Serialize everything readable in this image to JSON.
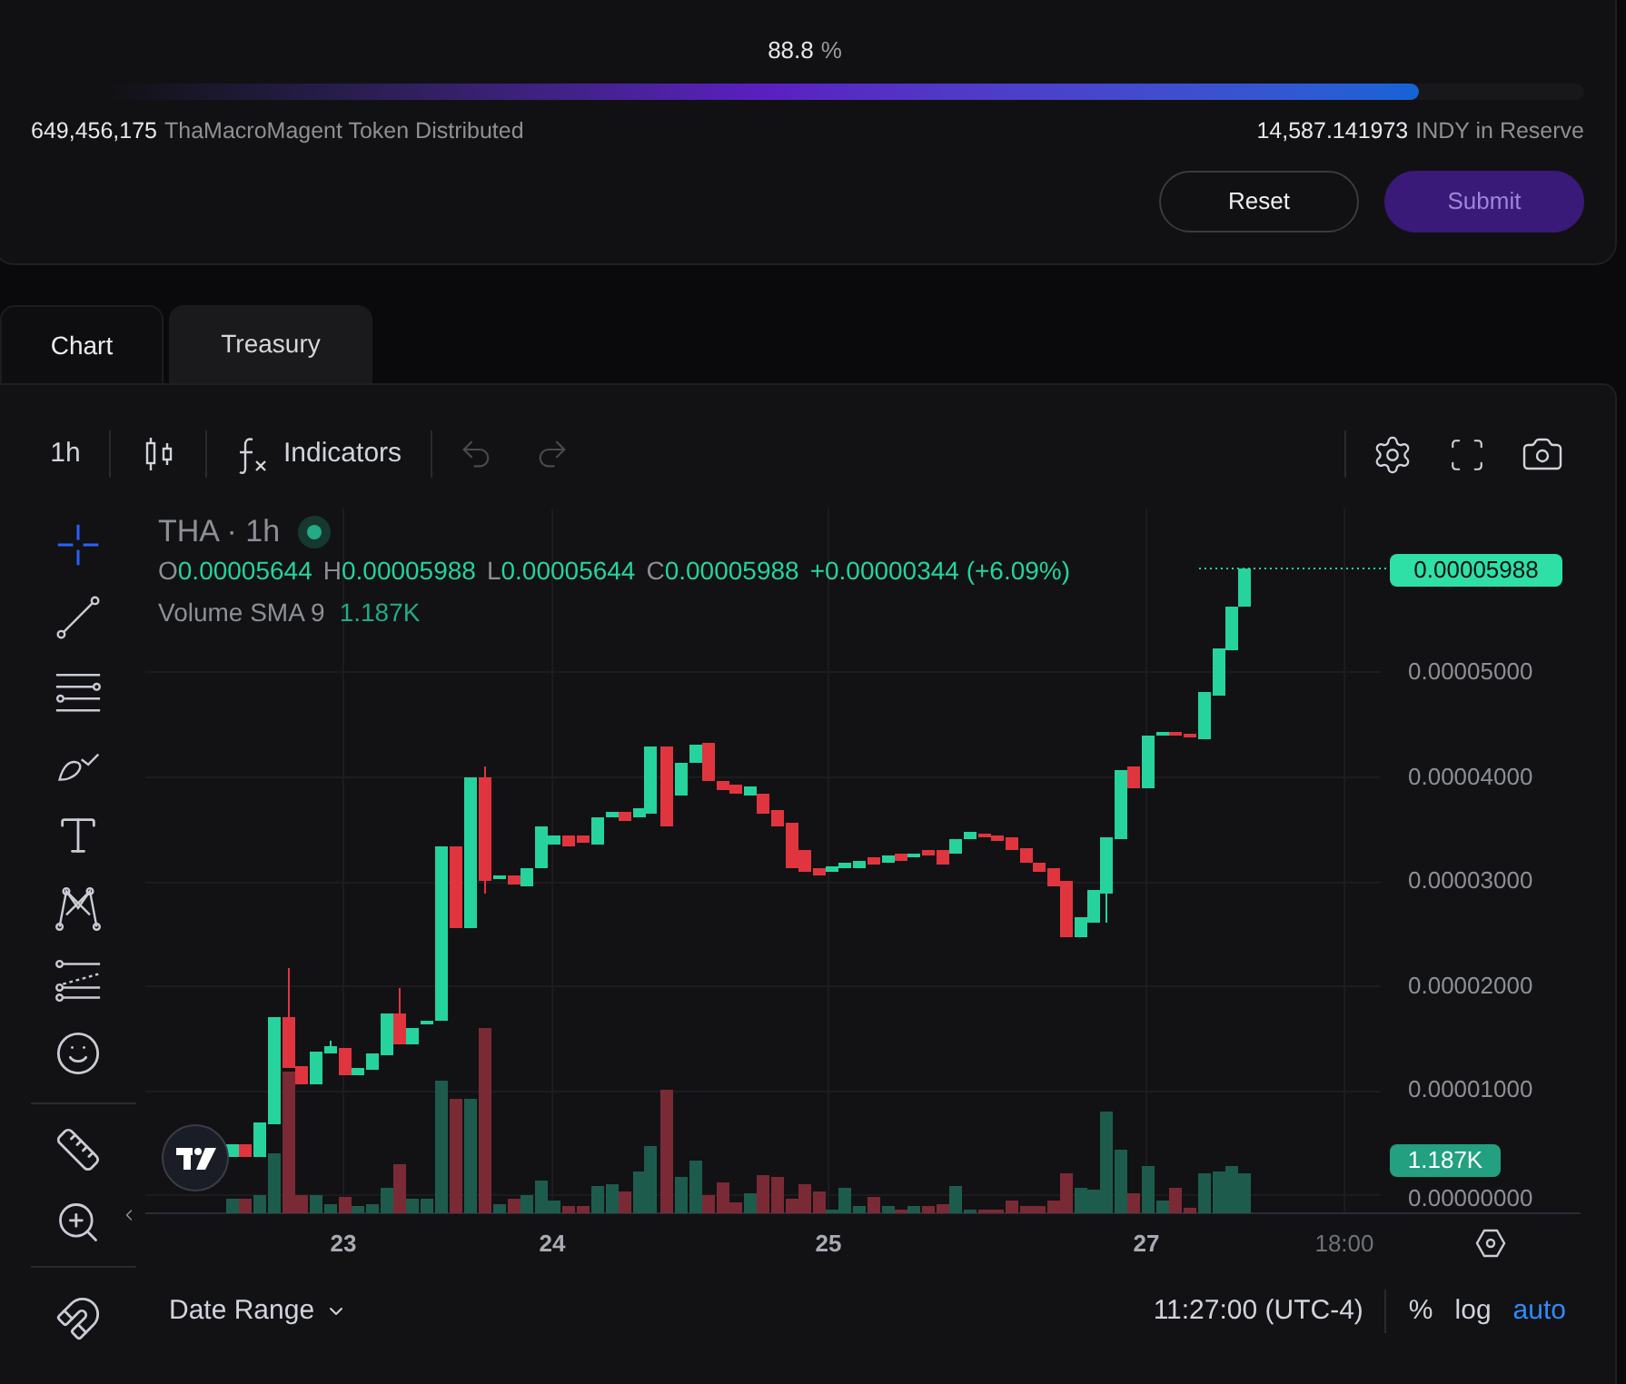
{
  "distribution": {
    "percent": "88.8",
    "percent_unit": "%",
    "level": 0.888,
    "distributed_amount": "649,456,175",
    "distributed_label": "ThaMacroMagent Token Distributed",
    "reserve_amount": "14,587.141973",
    "reserve_label": "INDY in Reserve"
  },
  "buttons": [
    {
      "label": "Reset",
      "kind": "outline"
    },
    {
      "label": "Submit",
      "kind": "primary"
    }
  ],
  "tabs": [
    {
      "label": "Chart",
      "selected": true
    },
    {
      "label": "Treasury",
      "selected": false
    }
  ],
  "toolbar": {
    "interval": "1h",
    "indicators": "Indicators",
    "undo": {
      "disabled": true
    },
    "redo": {
      "disabled": true
    }
  },
  "tools": [
    {
      "kind": "crosshair",
      "selected": true
    },
    {
      "kind": "trend-line",
      "selected": false
    },
    {
      "kind": "channel",
      "selected": false
    },
    {
      "kind": "brush",
      "selected": false
    },
    {
      "kind": "text",
      "selected": false
    },
    {
      "kind": "pattern",
      "selected": false
    },
    {
      "kind": "projection",
      "selected": false
    },
    {
      "kind": "emoji",
      "selected": false
    },
    {
      "kind": "ruler",
      "selected": false
    },
    {
      "kind": "zoom",
      "selected": false
    },
    {
      "kind": "magnet",
      "selected": false
    }
  ],
  "legend": {
    "symbol": "THA · 1h",
    "ohlc": [
      {
        "key": "O",
        "value": "0.00005644"
      },
      {
        "key": "H",
        "value": "0.00005988"
      },
      {
        "key": "L",
        "value": "0.00005644"
      },
      {
        "key": "C",
        "value": "0.00005988"
      }
    ],
    "change": "+0.00000344 (+6.09%)",
    "volume_label": "Volume SMA 9",
    "volume_value": "1.187K"
  },
  "price_axis": {
    "ticks": [
      "0.00005000",
      "0.00004000",
      "0.00003000",
      "0.00002000",
      "0.00001000",
      "0.00000000"
    ],
    "last_price": "0.00005988",
    "volume_badge": "1.187K"
  },
  "time_axis": [
    "23",
    "24",
    "25",
    "27",
    "18:00"
  ],
  "footer": {
    "date_range": "Date Range",
    "time": "11:27:00 (UTC-4)",
    "options": [
      {
        "label": "%",
        "selected": false
      },
      {
        "label": "log",
        "selected": false
      },
      {
        "label": "auto",
        "selected": true
      }
    ]
  }
}
